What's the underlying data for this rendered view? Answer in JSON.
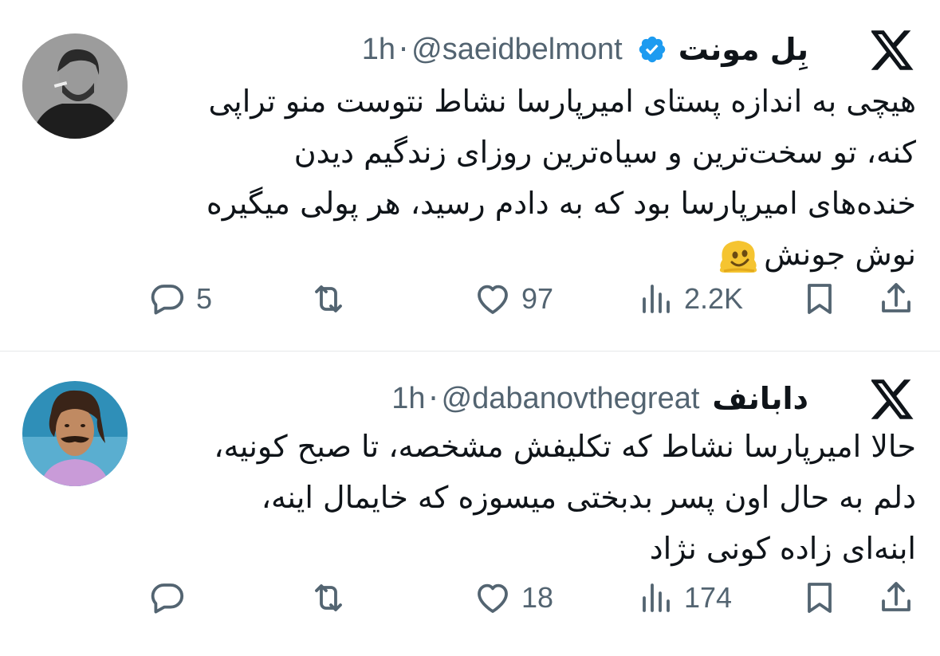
{
  "tweets": [
    {
      "author": "بِل مونت",
      "handle": "@saeidbelmont",
      "separator": "·",
      "time": "1h",
      "verified": true,
      "text": "هیچی به اندازه پستای امیرپارسا نشاط نتوست منو تراپی\nکنه، تو سخت‌ترین و سیاه‌ترین روزای زندگیم دیدن\nخنده‌های امیرپارسا بود که به دادم رسید، هر پولی میگیره\nنوش جونش",
      "emoji": "melting-face",
      "stats": {
        "replies": "5",
        "retweets": "",
        "likes": "97",
        "views": "2.2K"
      }
    },
    {
      "author": "دابانف",
      "handle": "@dabanovthegreat",
      "separator": "·",
      "time": "1h",
      "verified": false,
      "text": "حالا امیرپارسا نشاط که تکلیفش مشخصه، تا صبح کونیه،\nدلم به حال اون پسر بدبختی میسوزه که خایمال اینه،\nابنه‌ای زاده کونی نژاد",
      "stats": {
        "replies": "",
        "retweets": "",
        "likes": "18",
        "views": "174"
      }
    }
  ],
  "icons": {
    "platform": "x-logo-icon",
    "reply": "reply-icon",
    "retweet": "retweet-icon",
    "like": "heart-icon",
    "views": "views-icon",
    "bookmark": "bookmark-icon",
    "share": "share-icon",
    "verified": "verified-badge-icon"
  },
  "colors": {
    "text": "#0f1419",
    "secondary": "#536471",
    "verified": "#1d9bf0",
    "divider": "#e6e8ea"
  }
}
